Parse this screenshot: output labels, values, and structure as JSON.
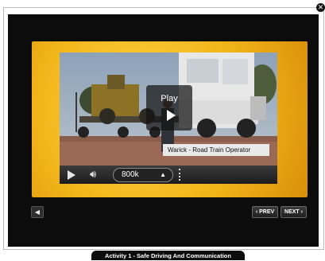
{
  "video": {
    "play_label": "Play",
    "caption": "Warick - Road Train Operator",
    "quality": "800k"
  },
  "nav": {
    "prev_label": "‹ PREV",
    "next_label": "NEXT ›"
  },
  "footer": {
    "title": "Activity 1 - Safe Driving And Communication"
  },
  "icons": {
    "close": "close-icon",
    "play": "play-icon",
    "volume": "volume-icon",
    "sound": "speaker-icon"
  }
}
